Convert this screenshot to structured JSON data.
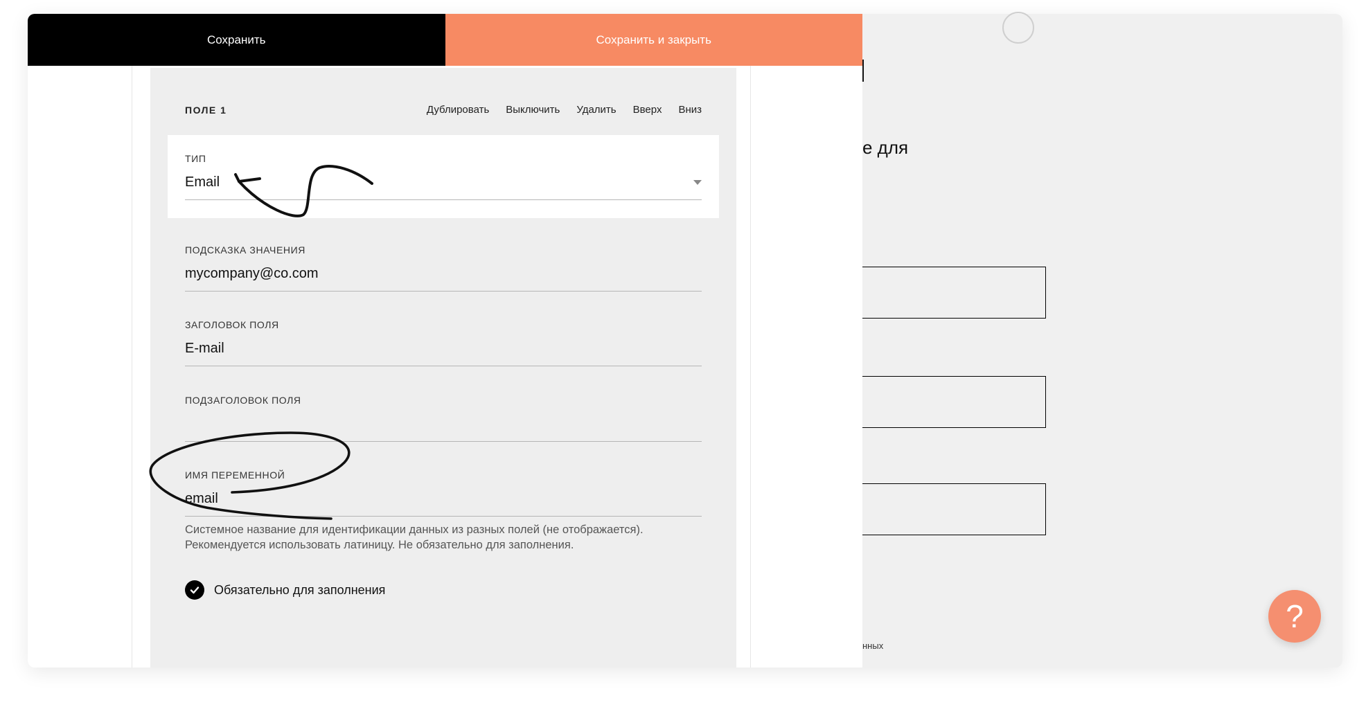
{
  "toolbar": {
    "save_label": "Сохранить",
    "save_close_label": "Сохранить и закрыть"
  },
  "field": {
    "title": "ПОЛЕ 1",
    "actions": [
      "Дублировать",
      "Выключить",
      "Удалить",
      "Вверх",
      "Вниз"
    ],
    "type": {
      "label": "ТИП",
      "value": "Email"
    },
    "placeholder": {
      "label": "ПОДСКАЗКА ЗНАЧЕНИЯ",
      "value": "mycompany@co.com"
    },
    "heading": {
      "label": "ЗАГОЛОВОК ПОЛЯ",
      "value": "E-mail"
    },
    "subheading": {
      "label": "ПОДЗАГОЛОВОК ПОЛЯ",
      "value": ""
    },
    "variable": {
      "label": "ИМЯ ПЕРЕМЕННОЙ",
      "value": "email",
      "hint_line1": "Системное название для идентификации данных из разных полей (не отображается).",
      "hint_line2": "Рекомендуется использовать латиницу. Не обязательно для заполнения."
    },
    "required": {
      "label": "Обязательно для заполнения",
      "checked": true
    }
  },
  "preview": {
    "fragment_1": "е для",
    "fragment_2": "нных"
  },
  "help": {
    "label": "?"
  },
  "colors": {
    "save_bg": "#000000",
    "save_close_bg": "#f78a63",
    "panel_bg": "#eeeeee",
    "help_bg": "#f58f70"
  }
}
